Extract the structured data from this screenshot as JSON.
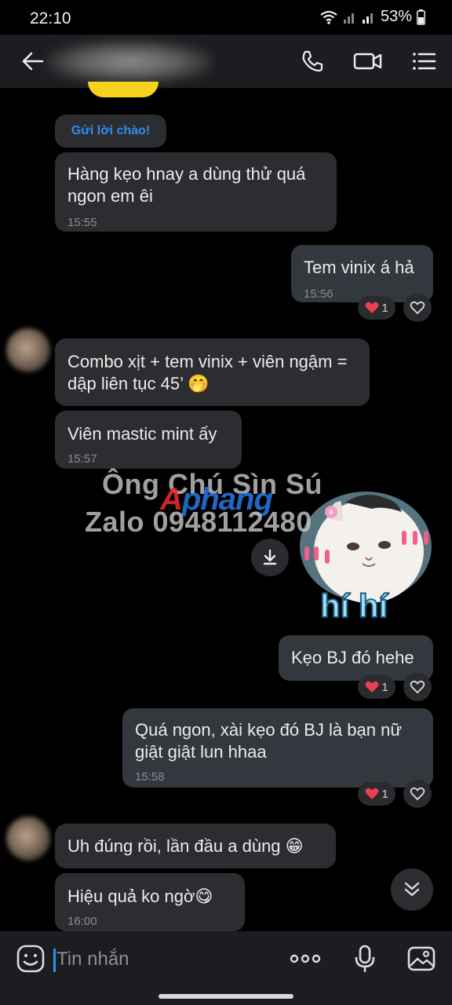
{
  "status_bar": {
    "time": "22:10",
    "battery": "53%"
  },
  "header": {
    "back_icon": "arrow-left-icon",
    "icons": [
      "phone-icon",
      "video-icon",
      "menu-list-icon"
    ]
  },
  "greeting_chip": "Gửi lời chào!",
  "messages": [
    {
      "dir": "in",
      "text": "Hàng kẹo hnay a dùng thử quá ngon em êi",
      "time": "15:55"
    },
    {
      "dir": "out",
      "text": "Tem vinix á hả",
      "time": "15:56",
      "reaction_count": "1"
    },
    {
      "dir": "in",
      "text": "Combo xịt + tem vinix + viên ngậm = dập liên tục 45’ 🤭",
      "time": ""
    },
    {
      "dir": "in",
      "text": "Viên mastic mint ấy",
      "time": "15:57"
    },
    {
      "dir": "out",
      "text": "Kẹo BJ đó hehe",
      "time": "",
      "reaction_count": "1"
    },
    {
      "dir": "out",
      "text": "Quá ngon, xài kẹo đó BJ là bạn nữ giật giật lun hhaa",
      "time": "15:58",
      "reaction_count": "1"
    },
    {
      "dir": "in",
      "text": "Uh đúng rồi, lần đầu a dùng 😁",
      "time": ""
    },
    {
      "dir": "in",
      "text": "Hiệu quả ko ngờ😋",
      "time": "16:00"
    }
  ],
  "watermark": {
    "line1": "Ông Chú Sìn Sú",
    "line2": "Zalo 0948112480",
    "logo_a": "A",
    "logo_rest": "phang"
  },
  "sticker": {
    "caption": "hí hí"
  },
  "composer": {
    "placeholder": "Tin nhắn"
  },
  "colors": {
    "accent": "#2f8ff4",
    "heart": "#e8414f",
    "bubble_in": "#2c2d30",
    "bubble_out": "#33373e"
  }
}
